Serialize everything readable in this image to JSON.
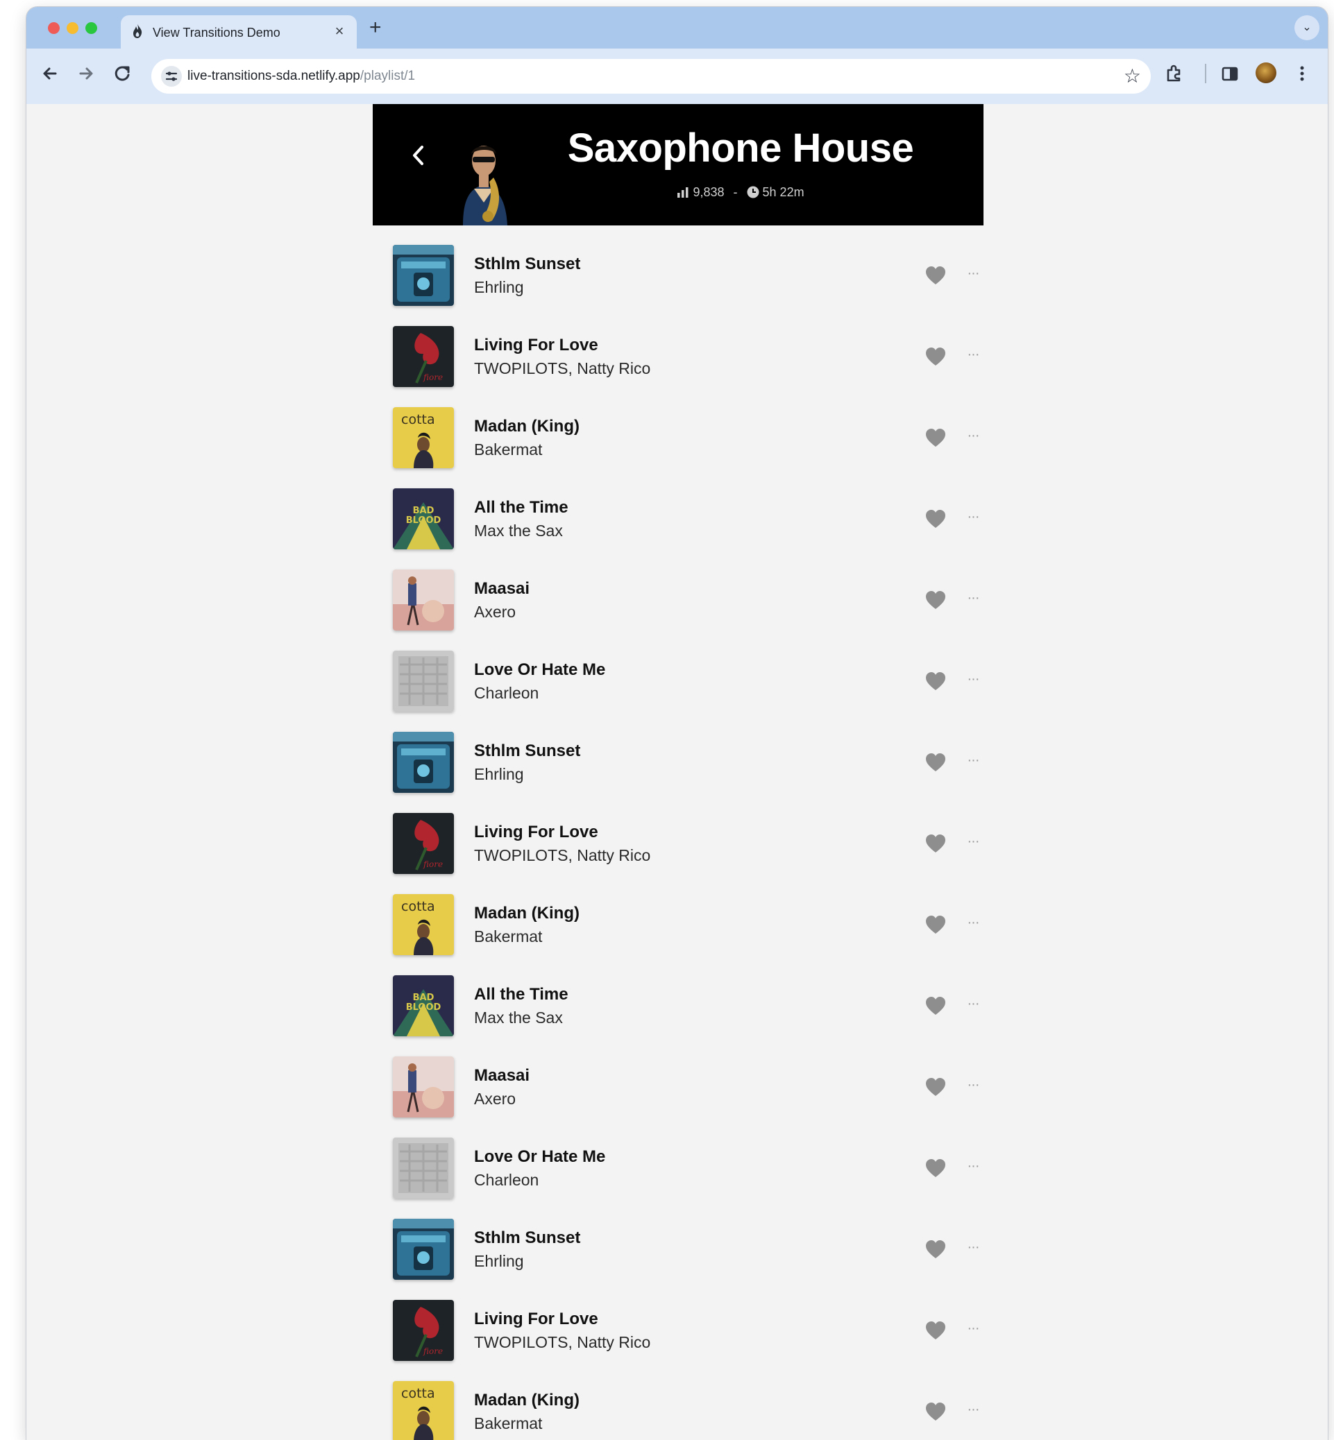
{
  "browser": {
    "tab_title": "View Transitions Demo",
    "tab_close": "×",
    "new_tab": "+",
    "tab_menu": "⌄",
    "url_host": "live-transitions-sda.netlify.app",
    "url_path": "/playlist/1"
  },
  "playlist": {
    "title": "Saxophone House",
    "plays": "9,838",
    "separator": "-",
    "duration": "5h 22m"
  },
  "tracks": [
    {
      "title": "Sthlm Sunset",
      "artist": "Ehrling",
      "art": "sthlm"
    },
    {
      "title": "Living For Love",
      "artist": "TWOPILOTS, Natty Rico",
      "art": "living"
    },
    {
      "title": "Madan (King)",
      "artist": "Bakermat",
      "art": "madan"
    },
    {
      "title": "All the Time",
      "artist": "Max the Sax",
      "art": "alltime"
    },
    {
      "title": "Maasai",
      "artist": "Axero",
      "art": "maasai"
    },
    {
      "title": "Love Or Hate Me",
      "artist": "Charleon",
      "art": "lovehate"
    },
    {
      "title": "Sthlm Sunset",
      "artist": "Ehrling",
      "art": "sthlm"
    },
    {
      "title": "Living For Love",
      "artist": "TWOPILOTS, Natty Rico",
      "art": "living"
    },
    {
      "title": "Madan (King)",
      "artist": "Bakermat",
      "art": "madan"
    },
    {
      "title": "All the Time",
      "artist": "Max the Sax",
      "art": "alltime"
    },
    {
      "title": "Maasai",
      "artist": "Axero",
      "art": "maasai"
    },
    {
      "title": "Love Or Hate Me",
      "artist": "Charleon",
      "art": "lovehate"
    },
    {
      "title": "Sthlm Sunset",
      "artist": "Ehrling",
      "art": "sthlm"
    },
    {
      "title": "Living For Love",
      "artist": "TWOPILOTS, Natty Rico",
      "art": "living"
    },
    {
      "title": "Madan (King)",
      "artist": "Bakermat",
      "art": "madan"
    }
  ],
  "track_actions": {
    "favorite_icon": "heart-icon",
    "more_label": "···"
  },
  "icons": {
    "back": "back-arrow-icon",
    "forward": "forward-arrow-icon",
    "reload": "reload-icon",
    "site_info": "tune-icon",
    "bookmark": "star-icon",
    "extensions": "puzzle-icon",
    "side_panel": "side-panel-icon",
    "menu": "kebab-menu-icon",
    "plays": "bar-chart-icon",
    "duration": "clock-icon"
  },
  "colors": {
    "tabbar": "#aac7ec",
    "toolbar": "#dce8f8",
    "hero_bg": "#000000",
    "page_bg": "#f3f3f3",
    "heart": "#8e8e8e",
    "title_text": "#111111"
  }
}
